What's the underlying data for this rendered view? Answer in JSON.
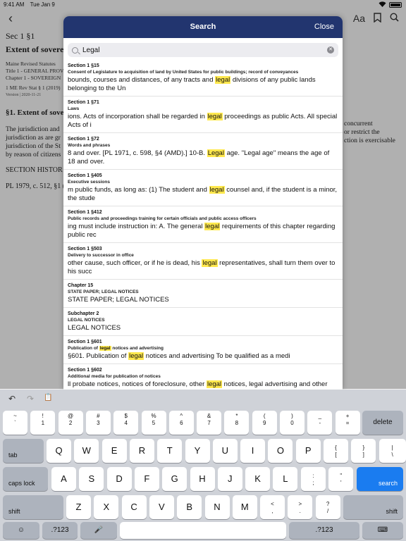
{
  "status": {
    "time": "9:41 AM",
    "date": "Tue Jan 9"
  },
  "nav": {
    "back": "‹",
    "text_size": "Aa",
    "icons": [
      "bookmark-icon",
      "search-icon"
    ]
  },
  "doc": {
    "sec": "Sec 1 §1",
    "extent": "Extent of sovereig",
    "meta": [
      "Maine Revised Statutes",
      "Title 1 - GENERAL PROV",
      "Chapter 1 - SOVEREIGN"
    ],
    "cite": "1 ME Rev Stat § 1 (2019)",
    "version": "Version | 2020-11-21",
    "heading": "§1. Extent of soverei",
    "body": [
      "The jurisdiction and",
      "jurisdiction as are gr",
      "jurisdiction of the St",
      "by reason of citizens"
    ],
    "right": [
      "concurrent",
      "or restrict the",
      "ction is exercisable"
    ],
    "history": "SECTION HISTOR",
    "pl": "PL 1979, c. 512, §1 ("
  },
  "modal": {
    "title": "Search",
    "close": "Close",
    "query": "Legal",
    "results": [
      {
        "sec": "Section 1 §15",
        "title": "Consent of Legislature to acquisition of land by United States for public buildings; record of conveyances",
        "pre": " bounds, courses and distances, of any tracts and ",
        "hit": "legal",
        "post": " divisions of any public lands belonging to the Un"
      },
      {
        "sec": "Section 1 §71",
        "title": "Laws",
        "pre": "ions.  Acts of incorporation shall be regarded in ",
        "hit": "legal",
        "post": " proceedings as public Acts. All special Acts of i"
      },
      {
        "sec": "Section 1 §72",
        "title": "Words and phrases",
        "pre": "8 and over.   [PL 1971, c. 598, §4 (AMD).] 10-B.  ",
        "hit": "Legal",
        "post": " age.  \"Legal age\" means the age of 18 and over."
      },
      {
        "sec": "Section 1 §405",
        "title": "Executive sessions",
        "pre": "m public funds, as long as:   (1) The student and ",
        "hit": "legal",
        "post": " counsel and, if the student is a minor, the stude"
      },
      {
        "sec": "Section 1 §412",
        "title": "Public records and proceedings training for certain officials and public access officers",
        "pre": "ing must include instruction in:   A. The general ",
        "hit": "legal",
        "post": " requirements of this chapter regarding public rec"
      },
      {
        "sec": "Section 1 §503",
        "title": "Delivery to successor in office",
        "pre": " other cause, such officer, or if he is dead, his ",
        "hit": "legal",
        "post": " representatives, shall turn them over to his succ"
      },
      {
        "sec": "Chapter 15",
        "title": "STATE PAPER; LEGAL NOTICES",
        "pre": "STATE PAPER; LEGAL NOTICES",
        "hit": "",
        "post": ""
      },
      {
        "sec": "Subchapter 2",
        "title": "LEGAL NOTICES",
        "pre": "LEGAL NOTICES",
        "hit": "",
        "post": ""
      },
      {
        "sec": "Section 1 §601",
        "title_pre": "Publication of ",
        "title_hit": "legal",
        "title_post": " notices and advertising",
        "pre": "§601. Publication of ",
        "hit": "legal",
        "post": " notices and advertising To be qualified as a medi"
      },
      {
        "sec": "Section 1 §602",
        "title": "Additional media for publication of notices",
        "pre": "ll probate notices, notices of foreclosure, other ",
        "hit": "legal",
        "post": " notices, legal advertising and other"
      }
    ]
  },
  "keyboard": {
    "row1": [
      {
        "top": "~",
        "bot": "`"
      },
      {
        "top": "!",
        "bot": "1"
      },
      {
        "top": "@",
        "bot": "2"
      },
      {
        "top": "#",
        "bot": "3"
      },
      {
        "top": "$",
        "bot": "4"
      },
      {
        "top": "%",
        "bot": "5"
      },
      {
        "top": "^",
        "bot": "6"
      },
      {
        "top": "&",
        "bot": "7"
      },
      {
        "top": "*",
        "bot": "8"
      },
      {
        "top": "(",
        "bot": "9"
      },
      {
        "top": ")",
        "bot": "0"
      },
      {
        "top": "_",
        "bot": "-"
      },
      {
        "top": "+",
        "bot": "="
      }
    ],
    "delete": "delete",
    "tab": "tab",
    "row2": [
      "Q",
      "W",
      "E",
      "R",
      "T",
      "Y",
      "U",
      "I",
      "O",
      "P"
    ],
    "row2_punct": [
      {
        "top": "{",
        "bot": "["
      },
      {
        "top": "}",
        "bot": "]"
      },
      {
        "top": "|",
        "bot": "\\"
      }
    ],
    "caps": "caps lock",
    "row3": [
      "A",
      "S",
      "D",
      "F",
      "G",
      "H",
      "J",
      "K",
      "L"
    ],
    "row3_punct": [
      {
        "top": ":",
        "bot": ";"
      },
      {
        "top": "\"",
        "bot": "'"
      }
    ],
    "search": "search",
    "shift": "shift",
    "row4": [
      "Z",
      "X",
      "C",
      "V",
      "B",
      "N",
      "M"
    ],
    "row4_punct": [
      {
        "top": "<",
        "bot": ","
      },
      {
        "top": ">",
        "bot": "."
      },
      {
        "top": "?",
        "bot": "/"
      }
    ],
    "numkey": ".?123",
    "emoji": "☺",
    "mic": "🎤",
    "hide": "⌨",
    "tools": {
      "undo": "↶",
      "redo": "↷",
      "paste": "📋"
    }
  }
}
